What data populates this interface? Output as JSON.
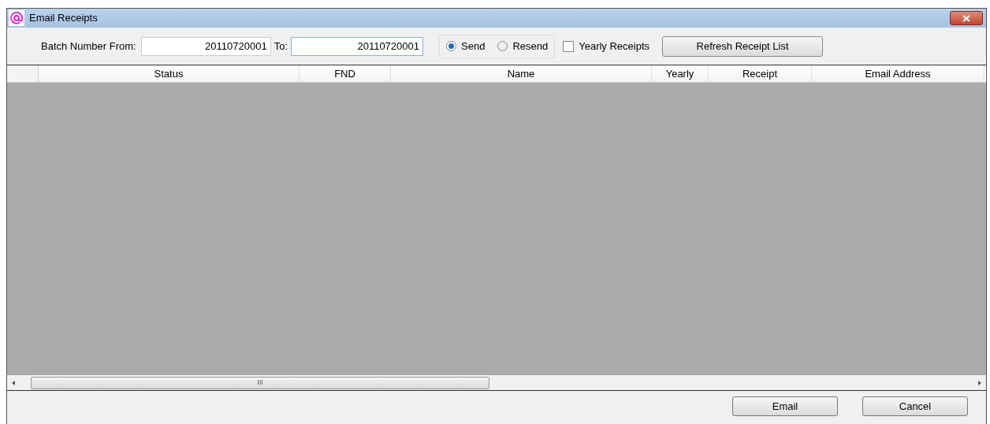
{
  "window": {
    "title": "Email Receipts"
  },
  "toolbar": {
    "batch_from_label": "Batch Number From:",
    "batch_from_value": "20110720001",
    "batch_to_label": "To:",
    "batch_to_value": "20110720001",
    "mode_options": [
      {
        "label": "Send",
        "selected": true
      },
      {
        "label": "Resend",
        "selected": false
      }
    ],
    "yearly_receipts": {
      "label": "Yearly Receipts",
      "checked": false
    },
    "refresh_button": "Refresh Receipt List"
  },
  "table": {
    "columns": [
      "Status",
      "FND",
      "Name",
      "Yearly",
      "Receipt",
      "Email Address"
    ]
  },
  "scroll_grip": "III",
  "buttons": [
    "Email",
    "Cancel"
  ]
}
